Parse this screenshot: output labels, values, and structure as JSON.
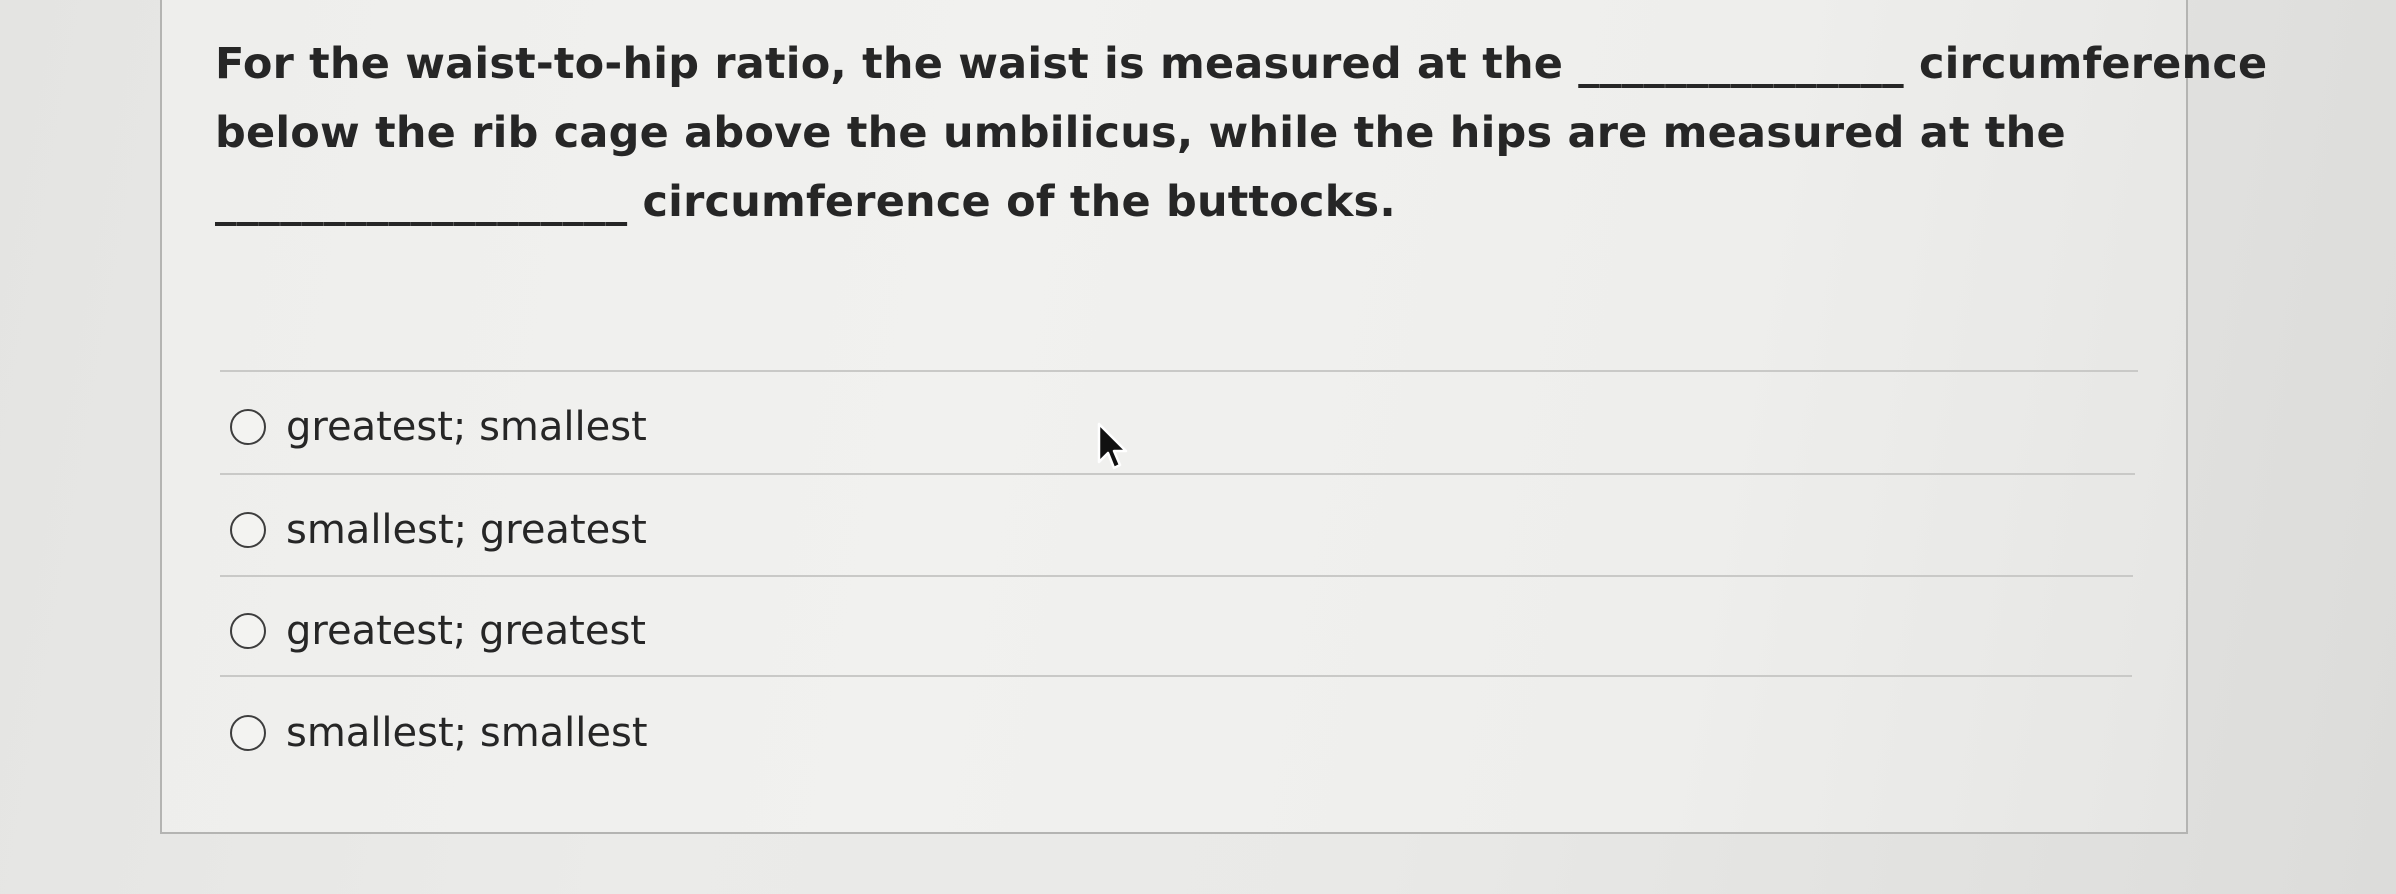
{
  "question": {
    "line1": "For the waist-to-hip ratio, the waist is measured at the _______________ circumference",
    "line2": "below the rib cage above the umbilicus, while the hips are measured at the",
    "line3": "___________________ circumference of the buttocks."
  },
  "options": [
    {
      "label": "greatest; smallest",
      "selected": false
    },
    {
      "label": "smallest; greatest",
      "selected": false
    },
    {
      "label": "greatest; greatest",
      "selected": false
    },
    {
      "label": "smallest; smallest",
      "selected": false
    }
  ],
  "colors": {
    "text": "#262626",
    "background": "#e8e8e6",
    "card": "#f0f0ee",
    "divider": "#c9c9c7"
  },
  "icons": {
    "cursor": "mouse-pointer-icon",
    "radio": "radio-button-unchecked-icon"
  }
}
